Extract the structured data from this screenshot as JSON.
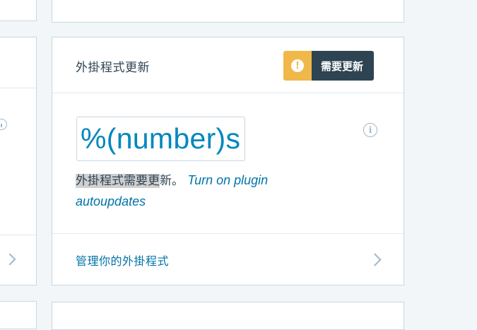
{
  "card": {
    "title": "外掛程式更新",
    "badge": {
      "icon": "exclamation-icon",
      "label": "需要更新",
      "accent": "#f0b849",
      "dark": "#2e4453"
    },
    "count": "%(number)s",
    "info_icon": "info-icon",
    "info_glyph": "i",
    "description": {
      "highlighted": "外掛程式需要更",
      "rest": "新。",
      "link": "Turn on plugin autoupdates"
    },
    "footer_link": "管理你的外掛程式",
    "footer_icon": "chevron-right-icon"
  },
  "colors": {
    "link": "#0073aa",
    "count": "#0087be",
    "background": "#f3f6f8",
    "border": "#c8d7e1"
  }
}
